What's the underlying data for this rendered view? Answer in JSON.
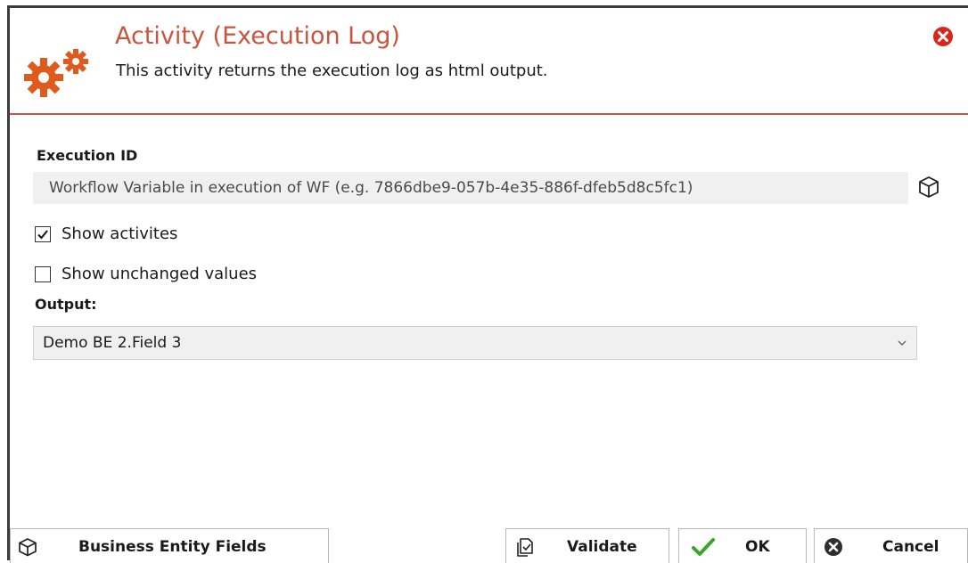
{
  "header": {
    "title": "Activity (Execution Log)",
    "subtitle": "This activity returns the execution log as html output.",
    "accent_color": "#c9553f",
    "icon": "gears-icon",
    "close_icon": "close-circle-icon"
  },
  "form": {
    "execution_id": {
      "label": "Execution ID",
      "placeholder": "Workflow Variable in execution of WF (e.g. 7866dbe9-057b-4e35-886f-dfeb5d8c5fc1)",
      "value": "",
      "side_icon": "cube-icon"
    },
    "show_activities": {
      "label": "Show activites",
      "checked": true
    },
    "show_unchanged": {
      "label": "Show unchanged values",
      "checked": false
    },
    "output": {
      "label": "Output:",
      "selected": "Demo BE 2.Field 3"
    }
  },
  "footer": {
    "business_entity_fields": {
      "label": "Business Entity Fields",
      "icon": "cube-icon"
    },
    "validate": {
      "label": "Validate",
      "icon": "validate-document-icon"
    },
    "ok": {
      "label": "OK",
      "icon": "checkmark-icon",
      "color": "#3aa52a"
    },
    "cancel": {
      "label": "Cancel",
      "icon": "cancel-circle-icon",
      "color": "#2e2e2e"
    }
  }
}
